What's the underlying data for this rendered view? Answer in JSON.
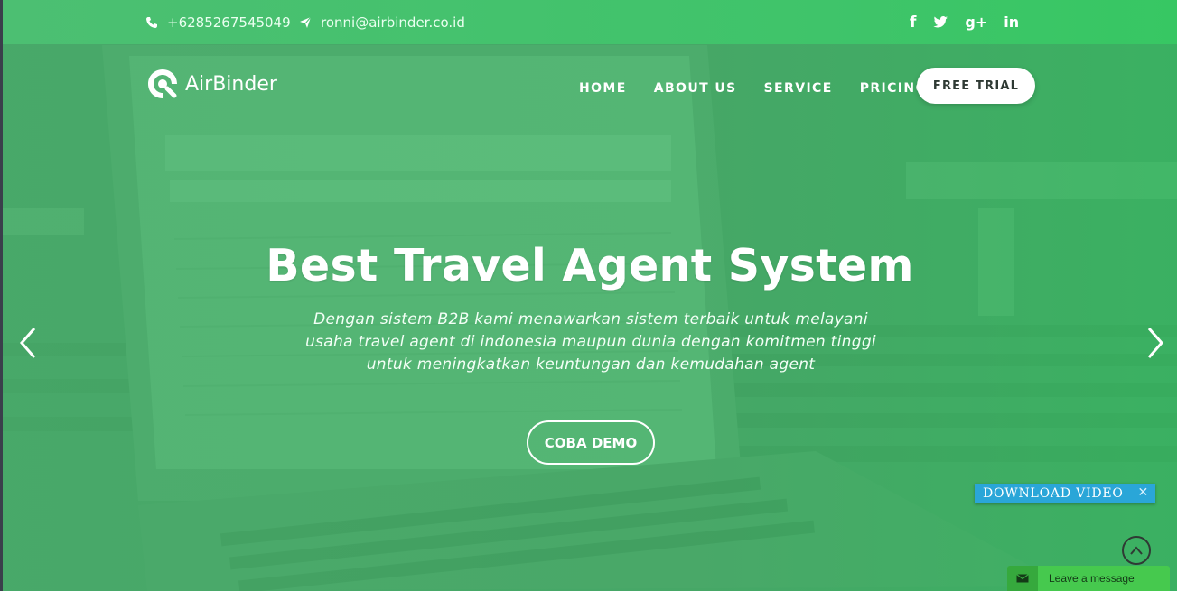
{
  "topbar": {
    "phone": "+6285267545049",
    "email": "ronni@airbinder.co.id",
    "social": [
      {
        "icon": "facebook-icon",
        "glyph": "f"
      },
      {
        "icon": "twitter-icon",
        "glyph": "🐦"
      },
      {
        "icon": "google-plus-icon",
        "glyph": "g+"
      },
      {
        "icon": "linkedin-icon",
        "glyph": "in"
      }
    ]
  },
  "brand": {
    "name": "AirBinder"
  },
  "nav": {
    "items": [
      "HOME",
      "ABOUT US",
      "SERVICE",
      "PRICING"
    ],
    "cta": "FREE TRIAL"
  },
  "hero": {
    "title": "Best Travel Agent System",
    "subtitle_lines": [
      "Dengan sistem B2B kami menawarkan sistem terbaik untuk melayani",
      "usaha travel agent di indonesia maupun dunia dengan komitmen tinggi",
      "untuk meningkatkan keuntungan dan kemudahan agent"
    ],
    "button": "COBA DEMO"
  },
  "widgets": {
    "download_video": "DOWNLOAD VIDEO",
    "download_close": "✕",
    "chat_label": "Leave a message"
  },
  "colors": {
    "overlay_green": "#48ba6e",
    "topbar_green": "#3fc46a",
    "video_blue": "#2aa6d8",
    "chat_green": "#46c94e"
  }
}
